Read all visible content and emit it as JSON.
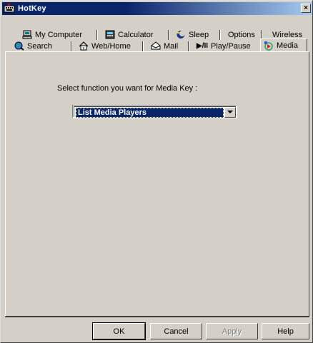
{
  "window": {
    "title": "HotKey",
    "close_glyph": "×",
    "icons": {
      "title": "hotkey-keyboard-icon",
      "close": "close-icon"
    }
  },
  "tabs": {
    "row1": [
      {
        "label": "My Computer",
        "icon": "computer-icon"
      },
      {
        "label": "Calculator",
        "icon": "calculator-icon"
      },
      {
        "label": "Sleep",
        "icon": "sleep-icon"
      },
      {
        "label": "Options",
        "icon": ""
      },
      {
        "label": "Wireless",
        "icon": ""
      }
    ],
    "row2": [
      {
        "label": "Search",
        "icon": "search-globe-icon"
      },
      {
        "label": "Web/Home",
        "icon": "web-home-icon"
      },
      {
        "label": "Mail",
        "icon": "mail-icon"
      },
      {
        "label": "Play/Pause",
        "icon": "play-pause-icon",
        "glyph": "▶/II"
      },
      {
        "label": "Media",
        "icon": "media-icon",
        "active": true
      }
    ]
  },
  "media_panel": {
    "prompt": "Select function you want for Media Key  :",
    "selected_function": "List Media Players",
    "dropdown_icon": "chevron-down-icon"
  },
  "buttons": {
    "ok": "OK",
    "cancel": "Cancel",
    "apply": "Apply",
    "help": "Help"
  },
  "colors": {
    "face": "#d4d0c8",
    "title_start": "#0a246a",
    "title_end": "#a6caf0",
    "selection": "#0a246a"
  }
}
